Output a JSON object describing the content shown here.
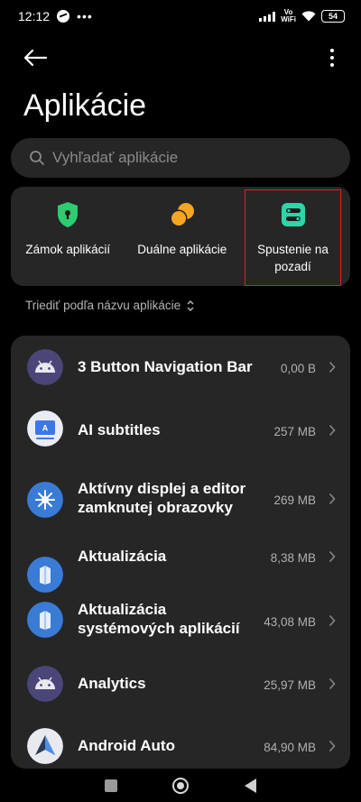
{
  "status": {
    "time": "12:12",
    "vo": "Vo",
    "wifi": "WiFi",
    "battery": "54"
  },
  "page_title": "Aplikácie",
  "search": {
    "placeholder": "Vyhľadať aplikácie"
  },
  "features": [
    {
      "label": "Zámok aplikácií",
      "icon": "shield-lock-icon",
      "color": "#2ecc71"
    },
    {
      "label": "Duálne aplikácie",
      "icon": "dual-apps-icon",
      "color": "#f5a623"
    },
    {
      "label": "Spustenie na pozadí",
      "icon": "toggle-switches-icon",
      "color": "#2bd6a8"
    }
  ],
  "sort": {
    "label": "Triediť podľa názvu aplikácie"
  },
  "apps": [
    {
      "name": "3 Button Navigation Bar",
      "size": "0,00 B",
      "icon": "android-icon"
    },
    {
      "name": "AI subtitles",
      "size": "257 MB",
      "icon": "subtitles-icon"
    },
    {
      "name": "Aktívny displej a editor zamknutej obrazovky",
      "size": "269 MB",
      "icon": "lockscreen-editor-icon"
    },
    {
      "name": "Aktualizácia",
      "size": "8,38 MB",
      "icon": "update-icon"
    },
    {
      "name": "Aktualizácia systémových aplikácií",
      "size": "43,08 MB",
      "icon": "system-update-icon"
    },
    {
      "name": "Analytics",
      "size": "25,97 MB",
      "icon": "android-icon"
    },
    {
      "name": "Android Auto",
      "size": "84,90 MB",
      "icon": "android-auto-icon"
    }
  ],
  "colors": {
    "background": "#000000",
    "card": "#262626",
    "highlight": "#d3262a"
  }
}
